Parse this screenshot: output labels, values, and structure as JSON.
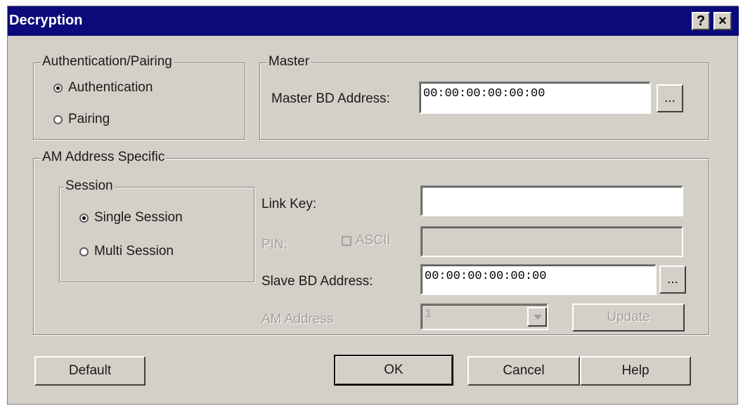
{
  "window": {
    "title": "Decryption",
    "help_glyph": "?",
    "close_glyph": "×"
  },
  "auth_pairing": {
    "legend": "Authentication/Pairing",
    "authentication_label": "Authentication",
    "pairing_label": "Pairing",
    "selected": "Authentication"
  },
  "master": {
    "legend": "Master",
    "bd_address_label": "Master BD Address:",
    "bd_address_value": "00:00:00:00:00:00",
    "browse_label": "..."
  },
  "am_specific": {
    "legend": "AM Address Specific",
    "session": {
      "legend": "Session",
      "single_label": "Single Session",
      "multi_label": "Multi Session",
      "selected": "Single Session"
    },
    "link_key_label": "Link Key:",
    "link_key_value": "",
    "pin_label": "PIN:",
    "ascii_label": "ASCII",
    "pin_value": "",
    "slave_bd_label": "Slave BD Address:",
    "slave_bd_value": "00:00:00:00:00:00",
    "slave_browse_label": "...",
    "am_address_label": "AM Address",
    "am_address_value": "1",
    "update_label": "Update"
  },
  "buttons": {
    "default_label": "Default",
    "ok_label": "OK",
    "cancel_label": "Cancel",
    "help_label": "Help"
  }
}
